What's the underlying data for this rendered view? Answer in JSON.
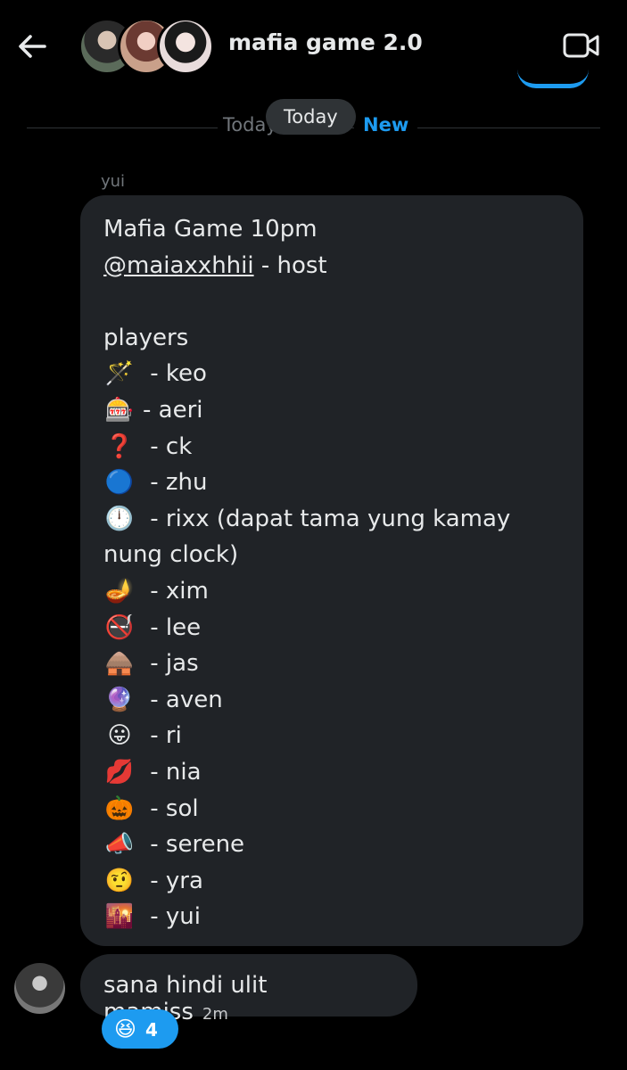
{
  "header": {
    "title": "mafia game 2.0"
  },
  "divider": {
    "today_label": "Today",
    "new_label": "New",
    "pill_label": "Today"
  },
  "message": {
    "sender": "yui",
    "lines": [
      {
        "text": "Mafia Game 10pm"
      },
      {
        "mention": "@maiaxxhhii",
        "text": " - host"
      },
      {
        "text": ""
      },
      {
        "text": "players"
      },
      {
        "emoji": "🪄",
        "text": " - keo"
      },
      {
        "emoji": "🎰",
        "text": "- aeri"
      },
      {
        "emoji": "❓",
        "text": " - ck"
      },
      {
        "emoji": "🔵",
        "text": " - zhu"
      },
      {
        "emoji": "🕛",
        "text": " - rixx (dapat tama yung kamay nung clock)"
      },
      {
        "emoji": "🪔",
        "text": " - xim"
      },
      {
        "emoji": "🚭",
        "text": " - lee"
      },
      {
        "emoji": "🛖",
        "text": " - jas"
      },
      {
        "emoji": "🔮",
        "text": " - aven"
      },
      {
        "emoji": "😛",
        "text": " - ri"
      },
      {
        "emoji": "💋",
        "text": " - nia"
      },
      {
        "emoji": "🎃",
        "text": " - sol"
      },
      {
        "emoji": "📣",
        "text": " - serene"
      },
      {
        "emoji": "🤨",
        "text": " - yra"
      },
      {
        "emoji": "🌇",
        "text": " - yui"
      }
    ]
  },
  "reply": {
    "text": "sana hindi ulit mamiss",
    "time": "2m",
    "reaction": {
      "emoji": "😆",
      "count": "4"
    }
  },
  "colors": {
    "accent": "#1d9bf0",
    "bubble": "#202327",
    "background": "#000000"
  }
}
